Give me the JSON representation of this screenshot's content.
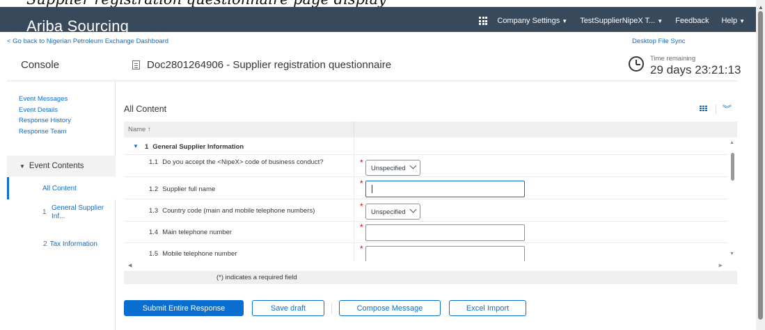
{
  "caption": "Supplier registration questionnaire page display",
  "header": {
    "brand": "Ariba Sourcing",
    "nav": {
      "company_settings": "Company Settings",
      "user": "TestSupplierNipeX T...",
      "feedback": "Feedback",
      "help": "Help"
    }
  },
  "links": {
    "back": "< Go back to Nigerian Petroleum Exchange Dashboard",
    "desktop_sync": "Desktop File Sync"
  },
  "page": {
    "console": "Console",
    "doc_title": "Doc2801264906 - Supplier registration questionnaire",
    "time_label": "Time remaining",
    "time_value": "29 days 23:21:13"
  },
  "sidebar": {
    "links": [
      "Event Messages",
      "Event Details",
      "Response History",
      "Response Team"
    ],
    "event_contents": "Event Contents",
    "all_content": "All Content",
    "items": [
      {
        "num": "1",
        "label": "General Supplier Inf..."
      },
      {
        "num": "2",
        "label": "Tax Information"
      }
    ]
  },
  "content": {
    "title": "All Content",
    "column_name": "Name ↑",
    "section": {
      "num": "1",
      "label": "General Supplier Information"
    },
    "rows": [
      {
        "num": "1.1",
        "label": "Do you accept the <NipeX> code of business conduct?",
        "value": "Unspecified"
      },
      {
        "num": "1.2",
        "label": "Supplier full name",
        "value": ""
      },
      {
        "num": "1.3",
        "label": "Country code (main and mobile telephone numbers)",
        "value": "Unspecified"
      },
      {
        "num": "1.4",
        "label": "Main telephone number",
        "value": ""
      },
      {
        "num": "1.5",
        "label": "Mobile telephone number",
        "value": ""
      }
    ],
    "required_note": "(*) indicates a required field"
  },
  "buttons": {
    "submit": "Submit Entire Response",
    "save": "Save draft",
    "compose": "Compose Message",
    "excel": "Excel Import"
  },
  "colors": {
    "header_bg": "#39495c",
    "accent": "#0a6ed1",
    "required": "#dd0000"
  }
}
